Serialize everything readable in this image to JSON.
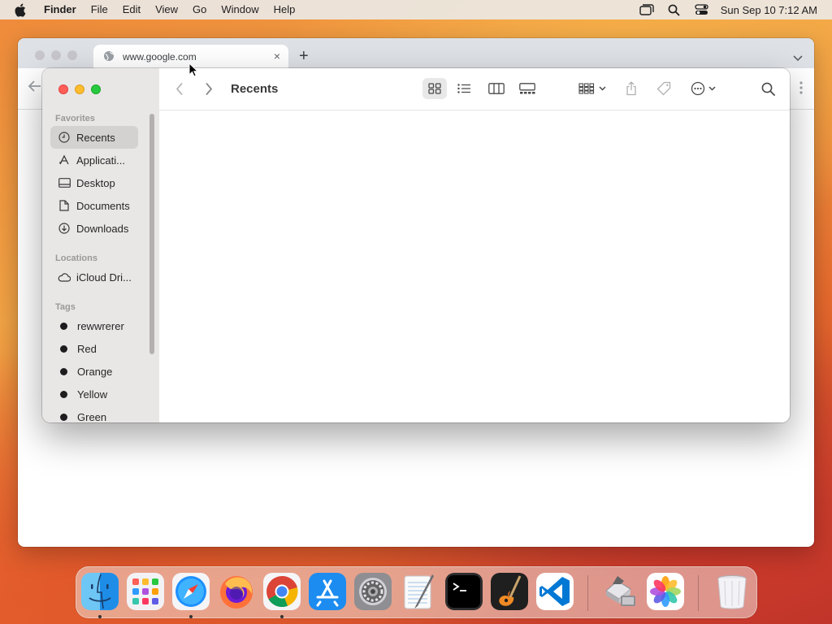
{
  "menubar": {
    "apple_icon": "apple-logo-icon",
    "app_name": "Finder",
    "menus": [
      "File",
      "Edit",
      "View",
      "Go",
      "Window",
      "Help"
    ],
    "status_icons": [
      "window-stack-icon",
      "spotlight-search-icon",
      "control-center-icon"
    ],
    "clock": "Sun Sep 10  7:12 AM"
  },
  "browser": {
    "tab_title": "www.google.com",
    "new_tab_symbol": "+",
    "tab_close_symbol": "×"
  },
  "finder": {
    "title": "Recents",
    "sidebar": {
      "favorites_label": "Favorites",
      "favorites": [
        {
          "label": "Recents",
          "icon": "clock-icon",
          "selected": true
        },
        {
          "label": "Applicati...",
          "icon": "applications-icon",
          "selected": false
        },
        {
          "label": "Desktop",
          "icon": "desktop-icon",
          "selected": false
        },
        {
          "label": "Documents",
          "icon": "document-icon",
          "selected": false
        },
        {
          "label": "Downloads",
          "icon": "download-icon",
          "selected": false
        }
      ],
      "locations_label": "Locations",
      "locations": [
        {
          "label": "iCloud Dri...",
          "icon": "cloud-icon"
        }
      ],
      "tags_label": "Tags",
      "tags": [
        {
          "label": "rewwrerer"
        },
        {
          "label": "Red"
        },
        {
          "label": "Orange"
        },
        {
          "label": "Yellow"
        },
        {
          "label": "Green"
        }
      ]
    },
    "toolbar_icons": [
      "icon-view-icon",
      "list-view-icon",
      "column-view-icon",
      "gallery-view-icon",
      "group-by-icon",
      "share-icon",
      "tag-icon",
      "more-actions-icon",
      "search-icon"
    ]
  },
  "dock": {
    "apps": [
      {
        "name": "Finder",
        "running": true
      },
      {
        "name": "Launchpad",
        "running": false
      },
      {
        "name": "Safari",
        "running": true
      },
      {
        "name": "Firefox",
        "running": false
      },
      {
        "name": "Google Chrome",
        "running": true
      },
      {
        "name": "App Store",
        "running": false
      },
      {
        "name": "System Settings",
        "running": false
      },
      {
        "name": "TextEdit",
        "running": false
      },
      {
        "name": "Terminal",
        "running": false
      },
      {
        "name": "GarageBand",
        "running": false
      },
      {
        "name": "Visual Studio Code",
        "running": false
      },
      {
        "name": "Migration Assistant",
        "running": false
      },
      {
        "name": "Photos",
        "running": false
      },
      {
        "name": "Trash",
        "running": false
      }
    ]
  },
  "colors": {
    "close": "#ff5f57",
    "minimize": "#febc2e",
    "maximize": "#28c840",
    "sidebar_bg": "#e9e6e6"
  }
}
